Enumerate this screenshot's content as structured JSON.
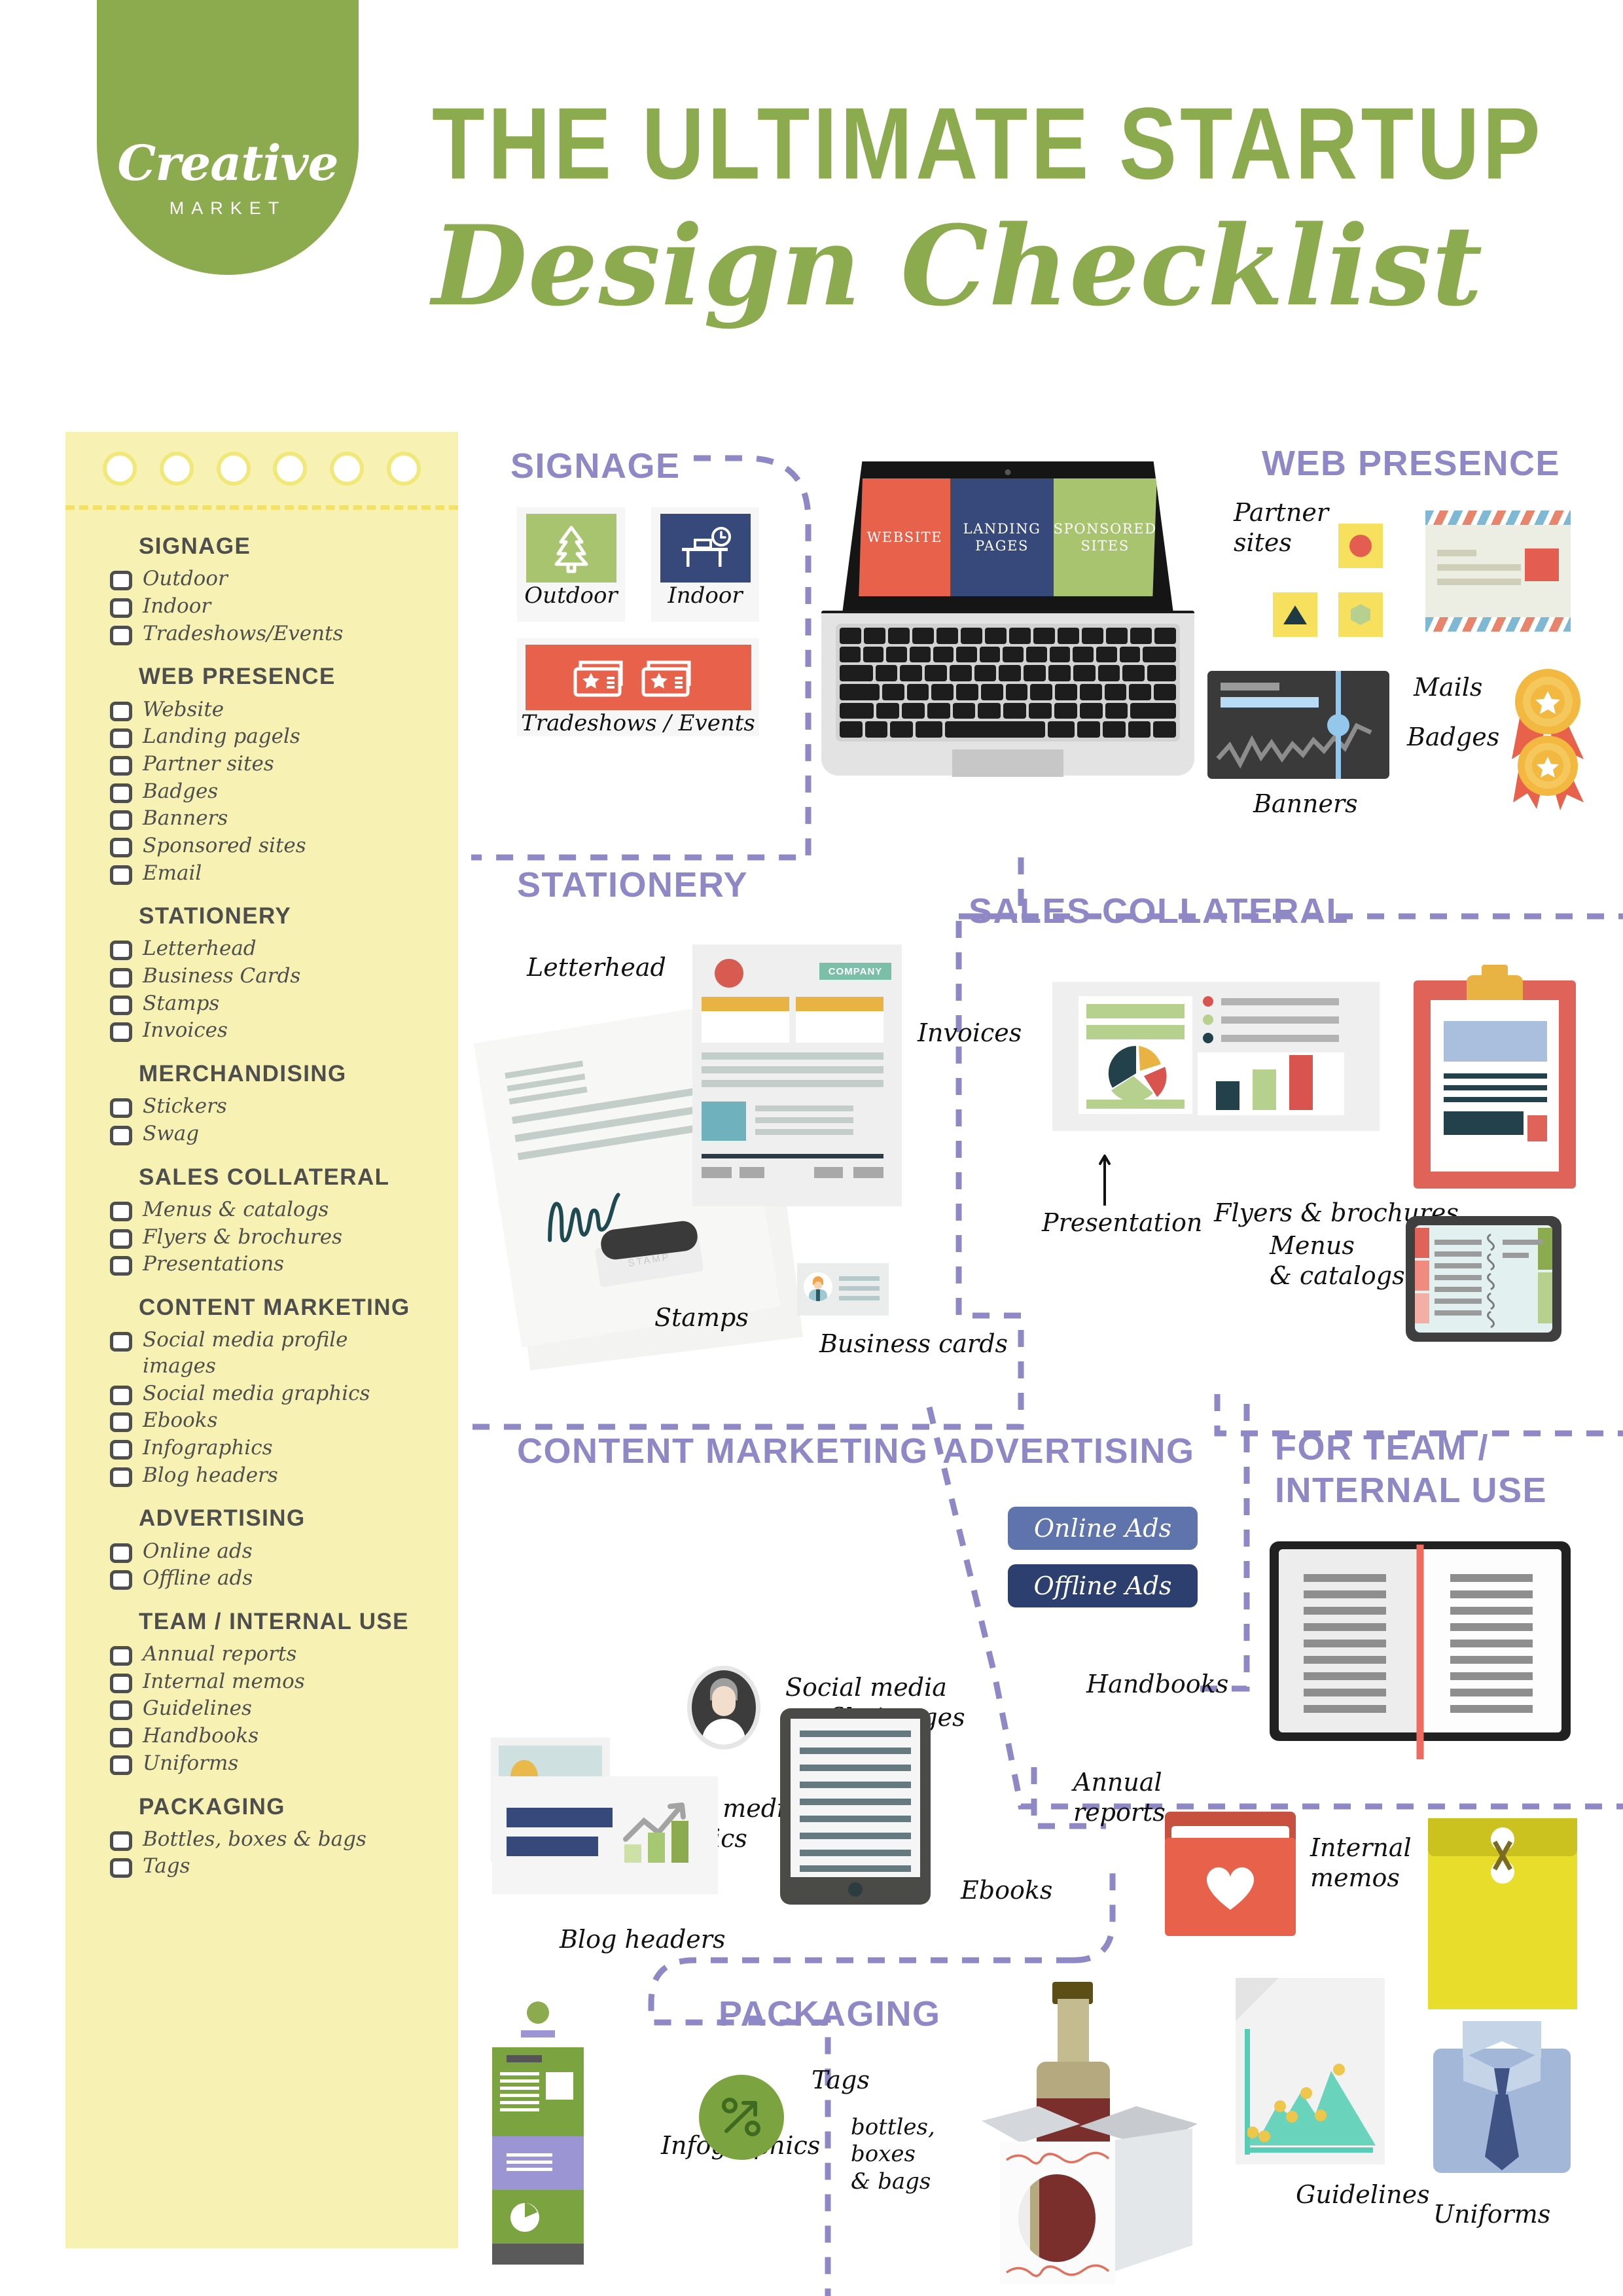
{
  "brand": {
    "logo_script": "Creative",
    "logo_sub": "MARKET",
    "logo_color": "#8cab4f"
  },
  "header": {
    "title_line1": "THE ULTIMATE STARTUP",
    "title_line2": "Design Checklist",
    "title_color": "#8cab4f"
  },
  "colors": {
    "note_bg": "#f7f2b4",
    "note_hole_ring": "#f1e87a",
    "section_heading": "#8e88c7",
    "dashed_connector": "#8e88c7",
    "accent_green": "#a3c267",
    "accent_red": "#e8614a",
    "accent_navy": "#36497a",
    "accent_yellow": "#e9c44c",
    "ink": "#4e4e4e"
  },
  "checklist": {
    "groups": [
      {
        "title": "SIGNAGE",
        "items": [
          "Outdoor",
          "Indoor",
          "Tradeshows/Events"
        ]
      },
      {
        "title": "WEB PRESENCE",
        "items": [
          "Website",
          "Landing pagels",
          "Partner sites",
          "Badges",
          "Banners",
          "Sponsored sites",
          "Email"
        ]
      },
      {
        "title": "STATIONERY",
        "items": [
          "Letterhead",
          "Business Cards",
          "Stamps",
          "Invoices"
        ]
      },
      {
        "title": "MERCHANDISING",
        "items": [
          "Stickers",
          "Swag"
        ]
      },
      {
        "title": "SALES COLLATERAL",
        "items": [
          "Menus & catalogs",
          "Flyers & brochures",
          "Presentations"
        ]
      },
      {
        "title": "CONTENT MARKETING",
        "items": [
          "Social media profile\nimages",
          "Social media graphics",
          "Ebooks",
          "Infographics",
          "Blog headers"
        ]
      },
      {
        "title": "ADVERTISING",
        "items": [
          "Online ads",
          "Offline ads"
        ]
      },
      {
        "title": "TEAM /\nINTERNAL USE",
        "items": [
          "Annual reports",
          "Internal memos",
          "Guidelines",
          "Handbooks",
          "Uniforms"
        ]
      },
      {
        "title": "PACKAGING",
        "items": [
          "Bottles, boxes & bags",
          "Tags"
        ]
      }
    ]
  },
  "sections": {
    "signage": {
      "heading": "SIGNAGE",
      "tiles": [
        {
          "caption": "Outdoor",
          "icon": "tree-icon",
          "color": "#a8c46f"
        },
        {
          "caption": "Indoor",
          "icon": "desk-clock-icon",
          "color": "#36497a"
        },
        {
          "caption": "Tradeshows / Events",
          "icon": "tickets-icon",
          "color": "#e8614a"
        }
      ]
    },
    "web_presence": {
      "heading": "WEB PRESENCE",
      "laptop_screen": [
        "WEBSITE",
        "LANDING\nPAGES",
        "SPONSORED\nSITES"
      ],
      "labels": {
        "partner_sites": "Partner\nsites",
        "mails": "Mails",
        "badges": "Badges",
        "banners": "Banners"
      }
    },
    "stationery": {
      "heading": "STATIONERY",
      "company_tag": "COMPANY",
      "stamp_text": "STAMP",
      "labels": {
        "letterhead": "Letterhead",
        "invoices": "Invoices",
        "stamps": "Stamps",
        "business_cards": "Business cards"
      }
    },
    "sales_collateral": {
      "heading": "SALES COLLATERAL",
      "labels": {
        "presentation": "Presentation",
        "flyers": "Flyers & brochures",
        "menus": "Menus\n& catalogs"
      }
    },
    "content_marketing": {
      "heading": "CONTENT\nMARKETING",
      "labels": {
        "profile_images": "Social media\nprofile images",
        "graphics": "Social media\ngraphics",
        "blog_headers": "Blog headers",
        "ebooks": "Ebooks",
        "infographics": "Infographics"
      }
    },
    "advertising": {
      "heading": "ADVERTISING",
      "buttons": [
        {
          "label": "Online Ads",
          "color": "#5f74ad"
        },
        {
          "label": "Offline Ads",
          "color": "#2c3f6e"
        }
      ]
    },
    "team_internal": {
      "heading": "FOR TEAM /\nINTERNAL USE",
      "labels": {
        "handbooks": "Handbooks",
        "annual_reports": "Annual\nreports",
        "internal_memos": "Internal\nmemos",
        "guidelines": "Guidelines",
        "uniforms": "Uniforms"
      }
    },
    "packaging": {
      "heading": "PACKAGING",
      "labels": {
        "tags": "Tags",
        "bottles": "bottles,\nboxes\n& bags"
      }
    }
  }
}
